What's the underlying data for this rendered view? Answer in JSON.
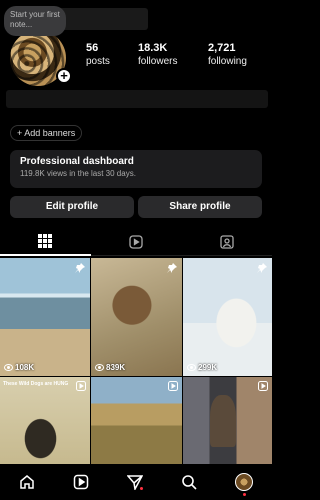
{
  "profile": {
    "note_placeholder": "Start your first note...",
    "stats": [
      {
        "value": "56",
        "label": "posts"
      },
      {
        "value": "18.3K",
        "label": "followers"
      },
      {
        "value": "2,721",
        "label": "following"
      }
    ],
    "add_banners": "+ Add banners",
    "dashboard": {
      "title": "Professional dashboard",
      "subtitle": "119.8K views in the last 30 days."
    },
    "edit_label": "Edit profile",
    "share_label": "Share profile"
  },
  "tabs": [
    "grid-icon",
    "reels-icon",
    "tagged-icon"
  ],
  "posts": [
    {
      "views": "108K",
      "pinned": true
    },
    {
      "views": "839K",
      "pinned": true
    },
    {
      "views": "299K",
      "pinned": true
    },
    {
      "caption": "These Wild Dogs are HUNG",
      "reel": true
    },
    {
      "reel": true
    },
    {
      "reel": true
    }
  ],
  "nav": [
    "home-icon",
    "reels-icon",
    "send-icon",
    "search-icon",
    "profile-avatar"
  ]
}
